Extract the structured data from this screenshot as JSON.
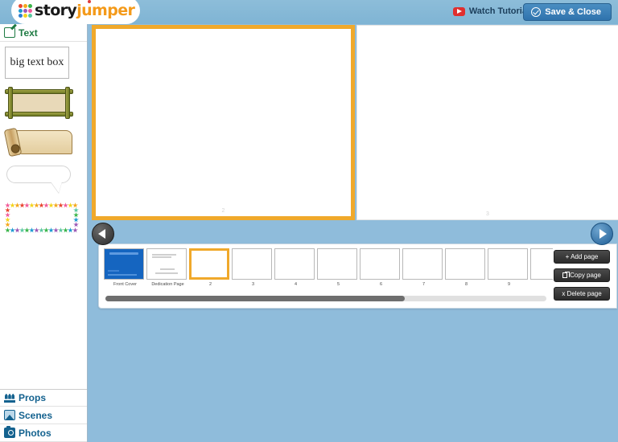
{
  "app": {
    "logo_primary": "story",
    "logo_secondary": "jumper",
    "logo_dot_colors": [
      "#e8462f",
      "#f4a81d",
      "#3bb54a",
      "#1d9bd1",
      "#9b59b6",
      "#f25c9a",
      "#2f7fd1",
      "#f4d41d",
      "#5ac8a0"
    ]
  },
  "topbar": {
    "watch_tutorial_label": "Watch Tutorial",
    "watch_tutorial_icon": "youtube-play-icon",
    "save_close_label": "Save & Close",
    "save_close_icon": "check-circle-icon",
    "save_close_color": "#2f73ad"
  },
  "sidebar": {
    "sections": [
      {
        "label": "Text",
        "icon": "edit-pencil-icon",
        "color": "#1d7a42",
        "active": true
      },
      {
        "label": "Props",
        "icon": "props-icon",
        "color": "#14628f",
        "active": false
      },
      {
        "label": "Scenes",
        "icon": "picture-icon",
        "color": "#14628f",
        "active": false
      },
      {
        "label": "Photos",
        "icon": "camera-icon",
        "color": "#14628f",
        "active": false
      }
    ],
    "text_items": [
      {
        "name": "big-text-box",
        "label": "big text box"
      },
      {
        "name": "bamboo-frame",
        "label": ""
      },
      {
        "name": "scroll-parchment",
        "label": ""
      },
      {
        "name": "speech-bubble",
        "label": ""
      },
      {
        "name": "star-border-frame",
        "label": ""
      }
    ],
    "star_colors": [
      "#f25c9a",
      "#3bb54a",
      "#f4d41d",
      "#1d9bd1",
      "#f4a81d",
      "#9b59b6",
      "#e8462f",
      "#5ac8a0"
    ]
  },
  "canvas": {
    "left_page_number": "2",
    "right_page_number": "3",
    "selected_border_color": "#f0a92b"
  },
  "nav": {
    "prev_icon": "chevron-left-icon",
    "prev_label": "Previous page",
    "next_icon": "chevron-right-icon",
    "next_label": "Next page"
  },
  "page_strip": {
    "thumbnails": [
      {
        "label": "Front Cover",
        "kind": "cover",
        "selected": false
      },
      {
        "label": "Dedication Page",
        "kind": "dedication",
        "selected": false
      },
      {
        "label": "2",
        "kind": "blank",
        "selected": true
      },
      {
        "label": "3",
        "kind": "blank",
        "selected": false
      },
      {
        "label": "4",
        "kind": "blank",
        "selected": false
      },
      {
        "label": "5",
        "kind": "blank",
        "selected": false
      },
      {
        "label": "6",
        "kind": "blank",
        "selected": false
      },
      {
        "label": "7",
        "kind": "blank",
        "selected": false
      },
      {
        "label": "8",
        "kind": "blank",
        "selected": false
      },
      {
        "label": "9",
        "kind": "blank",
        "selected": false
      },
      {
        "label": "",
        "kind": "blank",
        "selected": false
      }
    ],
    "buttons": [
      {
        "name": "add-page-button",
        "label": "+ Add page"
      },
      {
        "name": "copy-page-button",
        "label": "Copy page"
      },
      {
        "name": "delete-page-button",
        "label": "x Delete page"
      }
    ],
    "scroll_position_pct": 0
  }
}
